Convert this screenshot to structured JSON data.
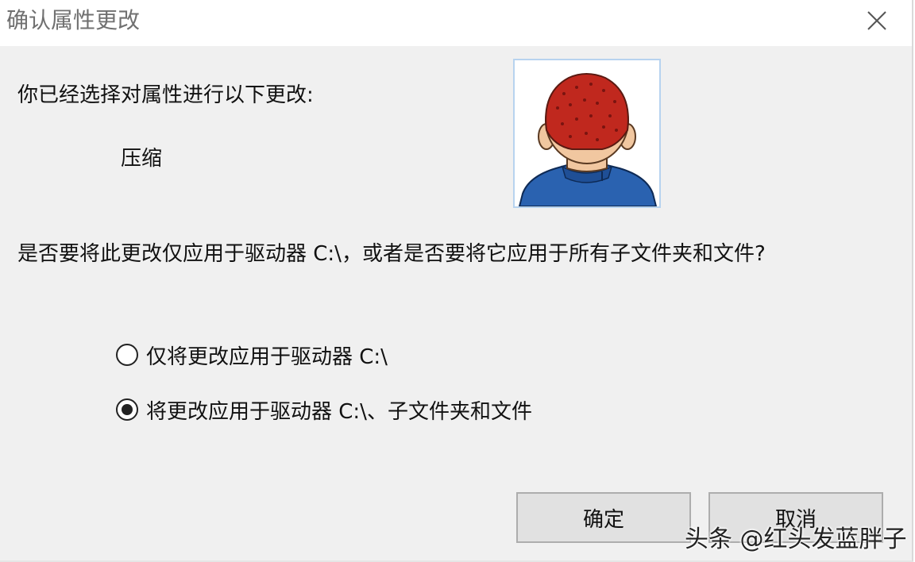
{
  "window": {
    "title": "确认属性更改"
  },
  "content": {
    "heading": "你已经选择对属性进行以下更改:",
    "change_item": "压缩",
    "question": "是否要将此更改仅应用于驱动器 C:\\，或者是否要将它应用于所有子文件夹和文件?"
  },
  "options": [
    {
      "label": "仅将更改应用于驱动器 C:\\",
      "selected": false
    },
    {
      "label": "将更改应用于驱动器 C:\\、子文件夹和文件",
      "selected": true
    }
  ],
  "buttons": {
    "ok": "确定",
    "cancel": "取消"
  },
  "watermark": "头条 @红头发蓝胖子",
  "icons": {
    "close": "close-icon",
    "avatar": "user-back-of-head-image"
  },
  "colors": {
    "title_text": "#707070",
    "dialog_bg": "#f0f0f0",
    "button_bg": "#e1e1e1",
    "hair": "#c0281e",
    "shirt": "#2a62b0"
  }
}
